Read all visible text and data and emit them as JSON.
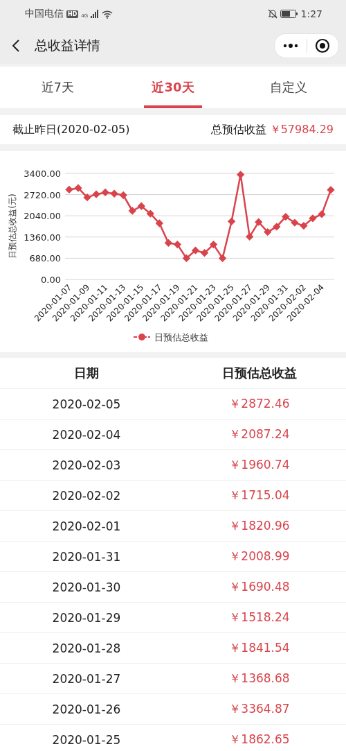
{
  "status_bar": {
    "carrier": "中国电信",
    "network_badge": "HD",
    "network_type": "4G",
    "time": "1:27"
  },
  "nav_bar": {
    "title": "总收益详情"
  },
  "tabs": [
    {
      "label": "近7天",
      "selected": false
    },
    {
      "label": "近30天",
      "selected": true
    },
    {
      "label": "自定义",
      "selected": false
    }
  ],
  "summary": {
    "date_label": "截止昨日(2020-02-05)",
    "total_label": "总预估收益",
    "total_value": "￥57984.29"
  },
  "chart": {
    "chart_data": {
      "type": "line",
      "ylabel": "日预估总收益(元)",
      "categories": [
        "2020-01-07",
        null,
        "2020-01-09",
        null,
        "2020-01-11",
        null,
        "2020-01-13",
        null,
        "2020-01-15",
        null,
        "2020-01-17",
        null,
        "2020-01-19",
        null,
        "2020-01-21",
        null,
        "2020-01-23",
        null,
        "2020-01-25",
        null,
        "2020-01-27",
        null,
        "2020-01-29",
        null,
        "2020-01-31",
        null,
        "2020-02-02",
        null,
        "2020-02-04",
        null
      ],
      "grid": true,
      "ylim": [
        0,
        3400
      ],
      "yticks": [
        {
          "value": 0,
          "label": "0.00"
        },
        {
          "value": 680,
          "label": "680.00"
        },
        {
          "value": 1360,
          "label": "1360.00"
        },
        {
          "value": 2040,
          "label": "2040.00"
        },
        {
          "value": 2720,
          "label": "2720.00"
        },
        {
          "value": 3400,
          "label": "3400.00"
        }
      ],
      "series": [
        {
          "name": "日预估总收益",
          "color": "#d9434b",
          "marker": "diamond",
          "values": [
            2880,
            2930,
            2630,
            2730,
            2790,
            2750,
            2700,
            2200,
            2350,
            2110,
            1800,
            1170,
            1120,
            680,
            930,
            850,
            1120,
            680,
            1860,
            3360,
            1370,
            1840,
            1520,
            1690,
            2010,
            1820,
            1720,
            1960,
            2090,
            2870
          ]
        }
      ]
    }
  },
  "table": {
    "columns": [
      "日期",
      "日预估总收益"
    ],
    "rows": [
      [
        "2020-02-05",
        "￥2872.46"
      ],
      [
        "2020-02-04",
        "￥2087.24"
      ],
      [
        "2020-02-03",
        "￥1960.74"
      ],
      [
        "2020-02-02",
        "￥1715.04"
      ],
      [
        "2020-02-01",
        "￥1820.96"
      ],
      [
        "2020-01-31",
        "￥2008.99"
      ],
      [
        "2020-01-30",
        "￥1690.48"
      ],
      [
        "2020-01-29",
        "￥1518.24"
      ],
      [
        "2020-01-28",
        "￥1841.54"
      ],
      [
        "2020-01-27",
        "￥1368.68"
      ],
      [
        "2020-01-26",
        "￥3364.87"
      ],
      [
        "2020-01-25",
        "￥1862.65"
      ]
    ]
  }
}
